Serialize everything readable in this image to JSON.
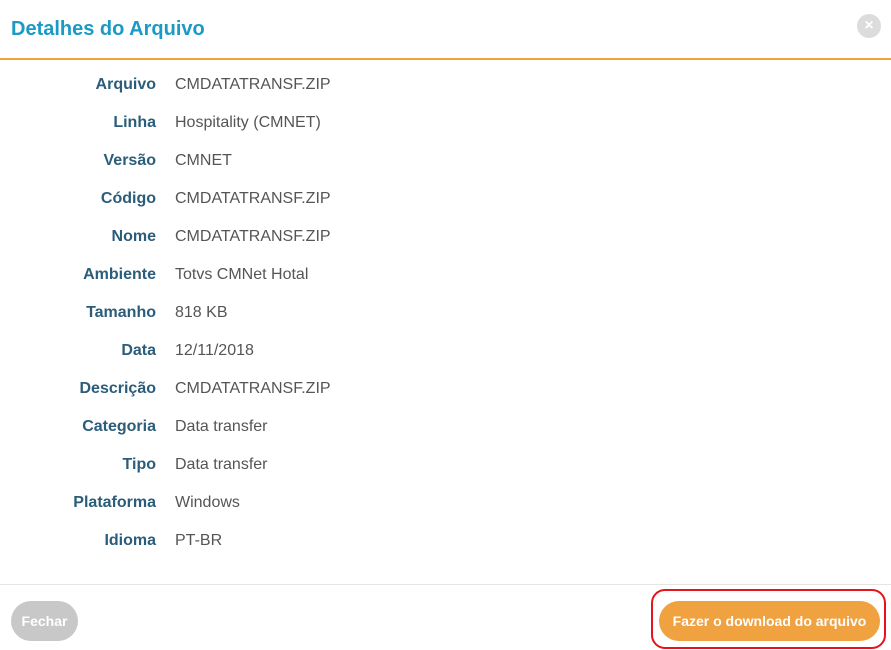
{
  "modal": {
    "title": "Detalhes do Arquivo",
    "close_icon": "×"
  },
  "details": [
    {
      "label": "Arquivo",
      "value": "CMDATATRANSF.ZIP"
    },
    {
      "label": "Linha",
      "value": "Hospitality (CMNET)"
    },
    {
      "label": "Versão",
      "value": "CMNET"
    },
    {
      "label": "Código",
      "value": "CMDATATRANSF.ZIP"
    },
    {
      "label": "Nome",
      "value": "CMDATATRANSF.ZIP"
    },
    {
      "label": "Ambiente",
      "value": "Totvs CMNet Hotal"
    },
    {
      "label": "Tamanho",
      "value": "818 KB"
    },
    {
      "label": "Data",
      "value": "12/11/2018"
    },
    {
      "label": "Descrição",
      "value": "CMDATATRANSF.ZIP"
    },
    {
      "label": "Categoria",
      "value": "Data transfer"
    },
    {
      "label": "Tipo",
      "value": "Data transfer"
    },
    {
      "label": "Plataforma",
      "value": "Windows"
    },
    {
      "label": "Idioma",
      "value": "PT-BR"
    }
  ],
  "footer": {
    "close_label": "Fechar",
    "download_label": "Fazer o download do arquivo"
  },
  "colors": {
    "accent": "#f0a140",
    "title": "#1a9ac5",
    "label": "#2b5d7b",
    "highlight": "#e3141b"
  }
}
